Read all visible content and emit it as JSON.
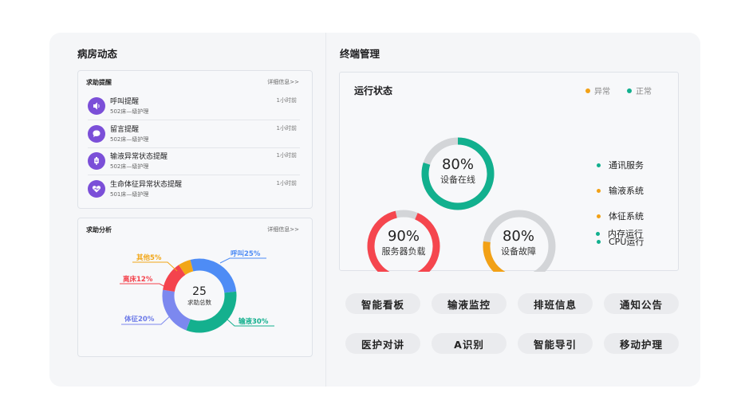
{
  "left": {
    "title": "病房动态",
    "alerts_card": {
      "title": "求助提醒",
      "link": "详细信息>>",
      "items": [
        {
          "title": "呼叫提醒",
          "sub": "502床—级护理",
          "time": "1小时前",
          "icon": "speaker-icon"
        },
        {
          "title": "留言提醒",
          "sub": "502床—级护理",
          "time": "1小时前",
          "icon": "chat-bubble-icon"
        },
        {
          "title": "输液异常状态提醒",
          "sub": "502床—级护理",
          "time": "1小时前",
          "icon": "iv-bag-icon"
        },
        {
          "title": "生命体征异常状态提醒",
          "sub": "501床—级护理",
          "time": "1小时前",
          "icon": "heart-pulse-icon"
        }
      ]
    },
    "analysis_card": {
      "title": "求助分析",
      "link": "详细信息>>",
      "center_value": "25",
      "center_label": "求助总数",
      "labels": {
        "hujiao": "呼叫25%",
        "shuye": "输液30%",
        "tizheng": "体征20%",
        "lichuang": "离床12%",
        "qita": "其他5%"
      }
    }
  },
  "chart_data": {
    "type": "pie",
    "categories": [
      "呼叫",
      "输液",
      "体征",
      "离床",
      "其他"
    ],
    "values": [
      25,
      30,
      20,
      12,
      5
    ],
    "colors": [
      "#4e8cf5",
      "#14b08e",
      "#7c88ef",
      "#f4434d",
      "#f2a616"
    ],
    "title": "求助分析"
  },
  "right": {
    "title": "终端管理",
    "status": {
      "title": "运行状态",
      "legend": [
        {
          "label": "异常",
          "color": "#f2a116"
        },
        {
          "label": "正常",
          "color": "#12b08e"
        }
      ],
      "rings": [
        {
          "pct": "80%",
          "label": "设备在线",
          "value": 0.8,
          "color": "#12b08e"
        },
        {
          "pct": "90%",
          "label": "服务器负载",
          "value": 0.9,
          "color": "#f5464e"
        },
        {
          "pct": "80%",
          "label": "设备故障",
          "value": 0.2,
          "color": "#f2a116"
        }
      ],
      "systems": [
        {
          "label": "通讯服务",
          "color": "#12b08e"
        },
        {
          "label": "输液系统",
          "color": "#f2a116"
        },
        {
          "label": "体征系统",
          "color": "#f2a116"
        },
        {
          "label": "CPU运行",
          "color": "#12b08e"
        },
        {
          "label": "内存运行",
          "color": "#12b08e"
        }
      ]
    },
    "buttons": [
      "智能看板",
      "输液监控",
      "排班信息",
      "通知公告",
      "医护对讲",
      "A识别",
      "智能导引",
      "移动护理"
    ]
  }
}
